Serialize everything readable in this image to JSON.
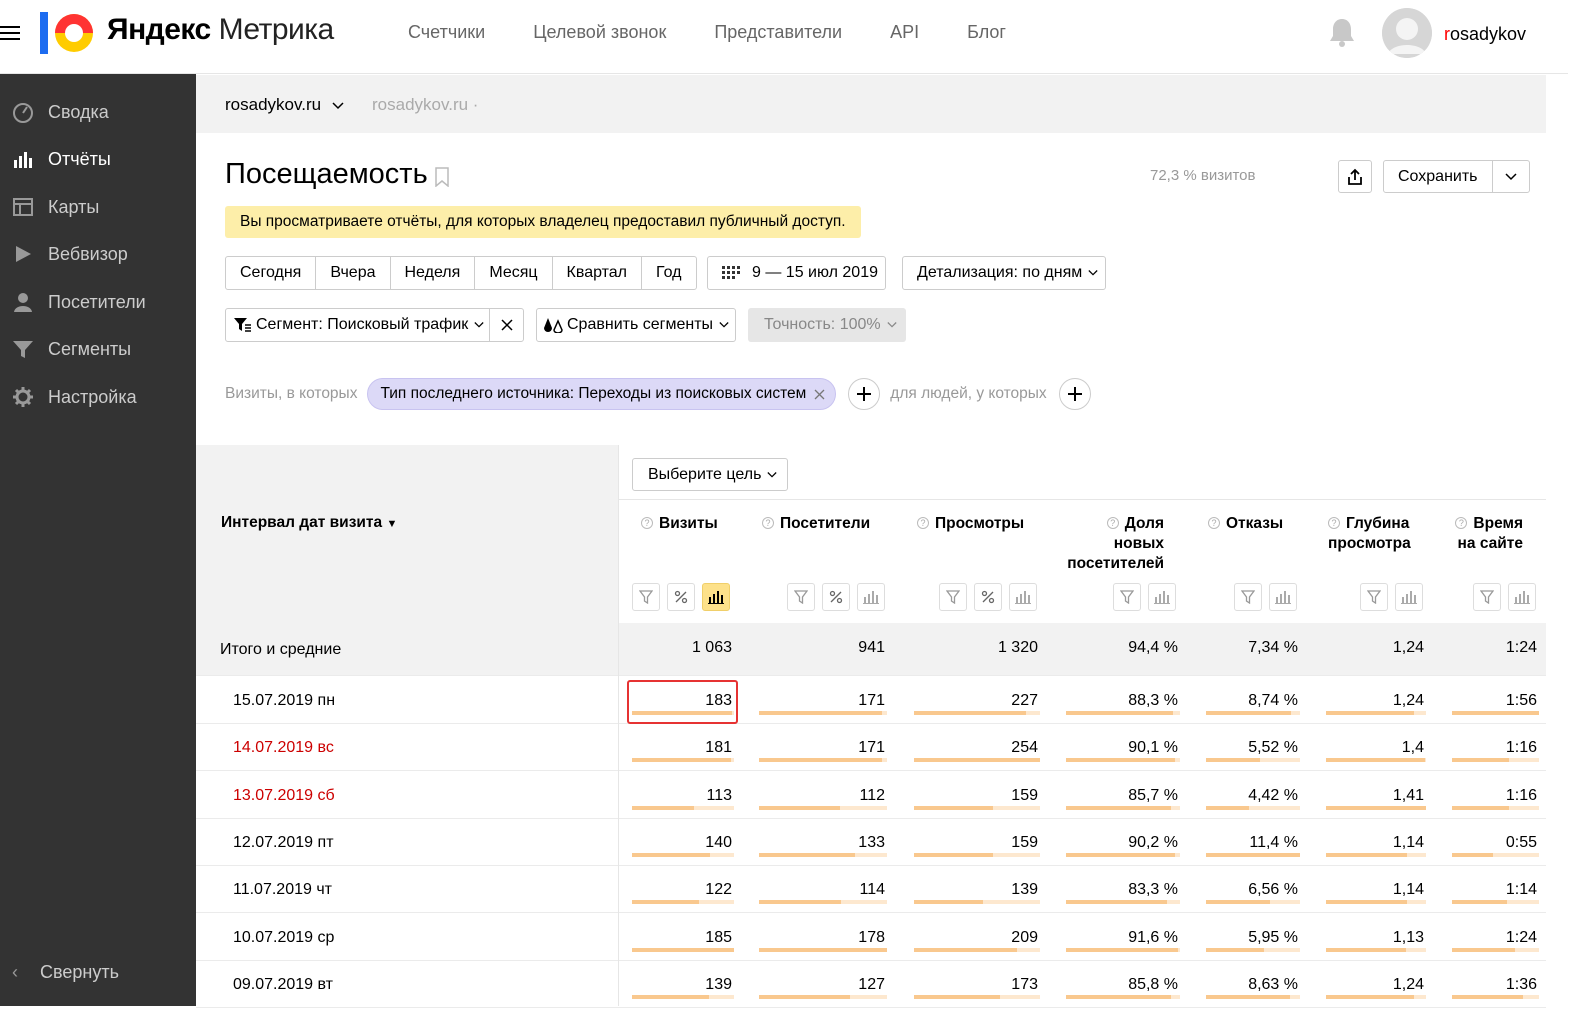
{
  "header": {
    "logo_brand": "Яндекс",
    "logo_product": "Метрика",
    "nav": [
      "Счетчики",
      "Целевой звонок",
      "Представители",
      "API",
      "Блог"
    ],
    "user_first_letter": "r",
    "user_rest": "osadykov"
  },
  "sidebar": {
    "items": [
      {
        "label": "Сводка",
        "icon": "gauge-icon",
        "active": false
      },
      {
        "label": "Отчёты",
        "icon": "bar-chart-icon",
        "active": true
      },
      {
        "label": "Карты",
        "icon": "map-icon",
        "active": false
      },
      {
        "label": "Вебвизор",
        "icon": "play-icon",
        "active": false
      },
      {
        "label": "Посетители",
        "icon": "person-icon",
        "active": false
      },
      {
        "label": "Сегменты",
        "icon": "funnel-icon",
        "active": false
      },
      {
        "label": "Настройка",
        "icon": "gear-icon",
        "active": false
      }
    ],
    "collapse": "Свернуть"
  },
  "breadcrumb": {
    "site": "rosadykov.ru",
    "site_path": "rosadykov.ru ·"
  },
  "report": {
    "title": "Посещаемость",
    "visits_share": "72,3 % визитов",
    "save": "Сохранить",
    "notice": "Вы просматриваете отчёты, для которых владелец предоставил публичный доступ.",
    "periods": [
      "Сегодня",
      "Вчера",
      "Неделя",
      "Месяц",
      "Квартал",
      "Год"
    ],
    "date_range": "9 — 15 июл 2019",
    "detail": "Детализация: по дням",
    "segment": "Сегмент: Поисковый трафик",
    "compare": "Сравнить сегменты",
    "accuracy": "Точность: 100%",
    "filter_label": "Визиты, в которых",
    "filter_chip": "Тип последнего источника: Переходы из поисковых систем",
    "filter_label2": "для людей, у которых",
    "goal": "Выберите цель"
  },
  "table": {
    "dimension_header": "Интервал дат визита",
    "sort_marker": "▼",
    "columns": [
      {
        "l1": "Визиты",
        "l2": "",
        "l3": ""
      },
      {
        "l1": "Посетители",
        "l2": "",
        "l3": ""
      },
      {
        "l1": "Просмотры",
        "l2": "",
        "l3": ""
      },
      {
        "l1": "Доля",
        "l2": "новых",
        "l3": "посетителей"
      },
      {
        "l1": "Отказы",
        "l2": "",
        "l3": ""
      },
      {
        "l1": "Глубина",
        "l2": "просмотра",
        "l3": ""
      },
      {
        "l1": "Время",
        "l2": "на сайте",
        "l3": ""
      }
    ],
    "total": {
      "label": "Итого и средние",
      "values": [
        "1 063",
        "941",
        "1 320",
        "94,4 %",
        "7,34 %",
        "1,24",
        "1:24"
      ]
    },
    "rows": [
      {
        "date": "15.07.2019 пн",
        "weekend": false,
        "values": [
          "183",
          "171",
          "227",
          "88,3 %",
          "8,74 %",
          "1,24",
          "1:56"
        ],
        "fills": [
          0.98,
          0.96,
          0.89,
          0.94,
          0.9,
          0.88,
          1.0
        ]
      },
      {
        "date": "14.07.2019 вс",
        "weekend": true,
        "values": [
          "181",
          "171",
          "254",
          "90,1 %",
          "5,52 %",
          "1,4",
          "1:16"
        ],
        "fills": [
          0.97,
          0.96,
          1.0,
          0.96,
          0.57,
          0.99,
          0.65
        ]
      },
      {
        "date": "13.07.2019 сб",
        "weekend": true,
        "values": [
          "113",
          "112",
          "159",
          "85,7 %",
          "4,42 %",
          "1,41",
          "1:16"
        ],
        "fills": [
          0.61,
          0.63,
          0.63,
          0.92,
          0.46,
          1.0,
          0.65
        ]
      },
      {
        "date": "12.07.2019 пт",
        "weekend": false,
        "values": [
          "140",
          "133",
          "159",
          "90,2 %",
          "11,4 %",
          "1,14",
          "0:55"
        ],
        "fills": [
          0.76,
          0.75,
          0.63,
          0.96,
          1.0,
          0.81,
          0.47
        ]
      },
      {
        "date": "11.07.2019 чт",
        "weekend": false,
        "values": [
          "122",
          "114",
          "139",
          "83,3 %",
          "6,56 %",
          "1,14",
          "1:14"
        ],
        "fills": [
          0.66,
          0.64,
          0.55,
          0.89,
          0.68,
          0.81,
          0.63
        ]
      },
      {
        "date": "10.07.2019 ср",
        "weekend": false,
        "values": [
          "185",
          "178",
          "209",
          "91,6 %",
          "5,95 %",
          "1,13",
          "1:24"
        ],
        "fills": [
          1.0,
          1.0,
          0.82,
          0.98,
          0.62,
          0.8,
          0.72
        ]
      },
      {
        "date": "09.07.2019 вт",
        "weekend": false,
        "values": [
          "139",
          "127",
          "173",
          "85,8 %",
          "8,63 %",
          "1,24",
          "1:36"
        ],
        "fills": [
          0.75,
          0.71,
          0.68,
          0.92,
          0.89,
          0.88,
          0.82
        ]
      }
    ]
  },
  "colors": {
    "sidebar_bg": "#333333",
    "notice_bg": "#fdeea9",
    "chip_bg": "#dcd9f7",
    "bar_fill": "#f9c88e",
    "weekend_text": "#cc0000",
    "highlight_border": "#e63333"
  }
}
